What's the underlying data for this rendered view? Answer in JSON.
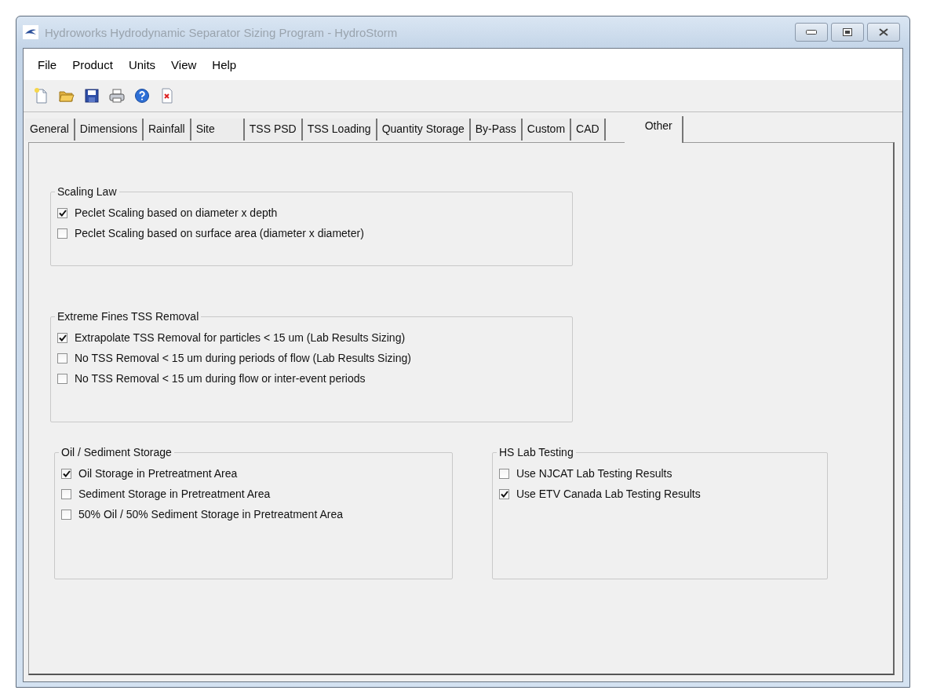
{
  "window": {
    "title": "Hydroworks Hydrodynamic Separator Sizing Program - HydroStorm"
  },
  "menu": [
    "File",
    "Product",
    "Units",
    "View",
    "Help"
  ],
  "tabs": [
    {
      "label": "General",
      "selected": false
    },
    {
      "label": "Dimensions",
      "selected": false
    },
    {
      "label": "Rainfall",
      "selected": false
    },
    {
      "label": "Site",
      "selected": false
    },
    {
      "label": "TSS PSD",
      "selected": false
    },
    {
      "label": "TSS Loading",
      "selected": false
    },
    {
      "label": "Quantity Storage",
      "selected": false
    },
    {
      "label": "By-Pass",
      "selected": false
    },
    {
      "label": "Custom",
      "selected": false
    },
    {
      "label": "CAD",
      "selected": false
    },
    {
      "label": "Other",
      "selected": true
    }
  ],
  "groups": [
    {
      "title": "Scaling Law",
      "options": [
        {
          "label": "Peclet Scaling based on diameter x depth",
          "checked": true
        },
        {
          "label": "Peclet Scaling based on surface area (diameter x diameter)",
          "checked": false
        }
      ]
    },
    {
      "title": "Extreme Fines TSS Removal",
      "options": [
        {
          "label": "Extrapolate TSS Removal for particles < 15 um (Lab Results Sizing)",
          "checked": true
        },
        {
          "label": "No TSS Removal < 15 um during periods of flow (Lab Results Sizing)",
          "checked": false
        },
        {
          "label": "No TSS Removal < 15 um during flow or inter-event periods",
          "checked": false
        }
      ]
    },
    {
      "title": "Oil / Sediment Storage",
      "options": [
        {
          "label": "Oil Storage in Pretreatment Area",
          "checked": true
        },
        {
          "label": "Sediment Storage in Pretreatment Area",
          "checked": false
        },
        {
          "label": "50% Oil / 50% Sediment Storage in Pretreatment Area",
          "checked": false
        }
      ]
    },
    {
      "title": "HS Lab Testing",
      "options": [
        {
          "label": "Use NJCAT Lab Testing Results",
          "checked": false
        },
        {
          "label": "Use ETV Canada Lab Testing Results",
          "checked": true
        }
      ]
    }
  ]
}
